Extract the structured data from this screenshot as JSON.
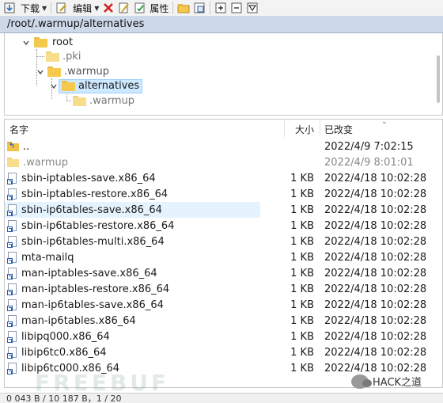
{
  "toolbar": {
    "download_label": "下载",
    "edit_label": "编辑",
    "properties_label": "属性"
  },
  "path": "/root/.warmup/alternatives",
  "tree": {
    "root": "root",
    "pki": ".pki",
    "warmup": ".warmup",
    "alternatives": "alternatives",
    "warmup_child": ".warmup"
  },
  "columns": {
    "name": "名字",
    "size": "大小",
    "modified": "已改变"
  },
  "rows": [
    {
      "name": "..",
      "size": "",
      "date": "2022/4/9 7:02:15"
    },
    {
      "name": ".warmup",
      "size": "",
      "date": "2022/4/9 8:01:01"
    },
    {
      "name": "sbin-iptables-save.x86_64",
      "size": "1 KB",
      "date": "2022/4/18 10:02:28"
    },
    {
      "name": "sbin-iptables-restore.x86_64",
      "size": "1 KB",
      "date": "2022/4/18 10:02:28"
    },
    {
      "name": "sbin-ip6tables-save.x86_64",
      "size": "1 KB",
      "date": "2022/4/18 10:02:28"
    },
    {
      "name": "sbin-ip6tables-restore.x86_64",
      "size": "1 KB",
      "date": "2022/4/18 10:02:28"
    },
    {
      "name": "sbin-ip6tables-multi.x86_64",
      "size": "1 KB",
      "date": "2022/4/18 10:02:28"
    },
    {
      "name": "mta-mailq",
      "size": "1 KB",
      "date": "2022/4/18 10:02:28"
    },
    {
      "name": "man-iptables-save.x86_64",
      "size": "1 KB",
      "date": "2022/4/18 10:02:28"
    },
    {
      "name": "man-iptables-restore.x86_64",
      "size": "1 KB",
      "date": "2022/4/18 10:02:28"
    },
    {
      "name": "man-ip6tables-save.x86_64",
      "size": "1 KB",
      "date": "2022/4/18 10:02:28"
    },
    {
      "name": "man-ip6tables.x86_64",
      "size": "1 KB",
      "date": "2022/4/18 10:02:28"
    },
    {
      "name": "libipq000.x86_64",
      "size": "1 KB",
      "date": "2022/4/18 10:02:28"
    },
    {
      "name": "libip6tc0.x86_64",
      "size": "1 KB",
      "date": "2022/4/18 10:02:28"
    },
    {
      "name": "libip6tc000.x86_64",
      "size": "1 KB",
      "date": "2022/4/18 10:02:28"
    }
  ],
  "watermark": "FREEBUF",
  "wechat_label": "HACK之道",
  "status_text": "0 043 B / 10 187 B，1 / 20"
}
